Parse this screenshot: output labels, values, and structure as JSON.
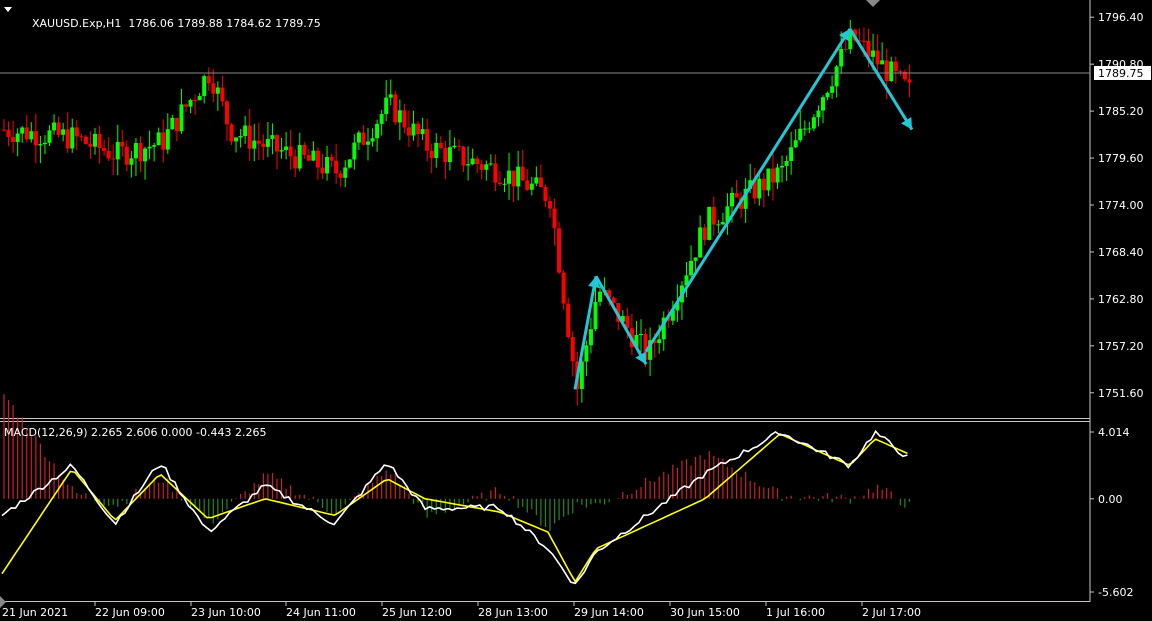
{
  "header": {
    "symbol": "XAUUSD.Exp,H1",
    "ohlc": "1786.06 1789.88 1784.62 1789.75"
  },
  "price_axis": {
    "labels": [
      "1796.40",
      "1790.80",
      "1785.20",
      "1779.60",
      "1774.00",
      "1768.40",
      "1762.80",
      "1757.20",
      "1751.60"
    ],
    "current_price_label": "1789.75"
  },
  "macd": {
    "title": "MACD(12,26,9) 2.265 2.606 0.000 -0.443 2.265",
    "axis_labels": [
      "4.014",
      "0.00",
      "-5.602"
    ]
  },
  "time_axis": {
    "labels": [
      "21 Jun 2021",
      "22 Jun 09:00",
      "23 Jun 10:00",
      "24 Jun 11:00",
      "25 Jun 12:00",
      "28 Jun 13:00",
      "29 Jun 14:00",
      "30 Jun 15:00",
      "1 Jul 16:00",
      "2 Jul 17:00"
    ]
  },
  "colors": {
    "background": "#000000",
    "bull": "#00ff00",
    "bear": "#ff0000",
    "arrow": "#22c8d8",
    "macd_line": "#ffffff",
    "signal_line": "#ffff00",
    "hist_pos": "#cc2222",
    "hist_neg": "#228822"
  },
  "chart_data": [
    {
      "type": "candlestick",
      "title": "XAUUSD.Exp,H1",
      "y_range": [
        1750.5,
        1797.5
      ],
      "current_price": 1789.75,
      "close_path": [
        {
          "x": "21 Jun 2021",
          "y": 1783.0
        },
        {
          "x": "22 Jun 09:00",
          "y": 1782.0
        },
        {
          "x": "22 Jun 09:00+",
          "y": 1780.0
        },
        {
          "x": "23 Jun 10:00",
          "y": 1781.5
        },
        {
          "x": "23 Jun 10:00+",
          "y": 1790.0
        },
        {
          "x": "23 Jun 10:00++",
          "y": 1783.0
        },
        {
          "x": "24 Jun 11:00",
          "y": 1781.0
        },
        {
          "x": "24 Jun 11:00+",
          "y": 1778.0
        },
        {
          "x": "25 Jun 12:00",
          "y": 1786.0
        },
        {
          "x": "25 Jun 12:00+",
          "y": 1781.0
        },
        {
          "x": "28 Jun 13:00",
          "y": 1778.0
        },
        {
          "x": "28 Jun 13:00+",
          "y": 1775.0
        },
        {
          "x": "29 Jun 14:00",
          "y": 1752.0
        },
        {
          "x": "29 Jun 14:00+",
          "y": 1764.0
        },
        {
          "x": "29 Jun 14:00++",
          "y": 1756.0
        },
        {
          "x": "30 Jun 15:00",
          "y": 1772.0
        },
        {
          "x": "1 Jul 16:00",
          "y": 1778.0
        },
        {
          "x": "1 Jul 16:00+",
          "y": 1794.0
        },
        {
          "x": "2 Jul 17:00",
          "y": 1787.0
        },
        {
          "x": "2 Jul 17:00+",
          "y": 1789.75
        }
      ],
      "annotations": [
        {
          "type": "arrow",
          "from": {
            "x": "29 Jun 14:00",
            "y": 1752.0
          },
          "to": {
            "x": "29 Jun 14:00+",
            "y": 1765.5
          }
        },
        {
          "type": "arrow",
          "from": {
            "x": "29 Jun 14:00+",
            "y": 1765.5
          },
          "to": {
            "x": "29 Jun 14:00++",
            "y": 1755.0
          }
        },
        {
          "type": "arrow",
          "from": {
            "x": "29 Jun 14:00++",
            "y": 1756.5
          },
          "to": {
            "x": "1 Jul 16:00+",
            "y": 1795.0
          }
        },
        {
          "type": "arrow",
          "from": {
            "x": "1 Jul 16:00+",
            "y": 1795.0
          },
          "to": {
            "x": "2 Jul 17:00+",
            "y": 1783.0
          }
        }
      ]
    },
    {
      "type": "line",
      "title": "MACD(12,26,9)",
      "y_range": [
        -5.602,
        4.014
      ],
      "values_text": "2.265 2.606 0.000 -0.443 2.265",
      "macd_path": [
        {
          "x": "21 Jun 2021",
          "y": -1.0
        },
        {
          "x": "22 Jun 09:00",
          "y": 2.0
        },
        {
          "x": "22 Jun 09:00+",
          "y": -1.5
        },
        {
          "x": "23 Jun 10:00",
          "y": 2.2
        },
        {
          "x": "23 Jun 10:00+",
          "y": -2.0
        },
        {
          "x": "24 Jun 11:00",
          "y": 0.8
        },
        {
          "x": "24 Jun 11:00+",
          "y": -1.5
        },
        {
          "x": "25 Jun 12:00",
          "y": 2.2
        },
        {
          "x": "25 Jun 12:00+",
          "y": -0.6
        },
        {
          "x": "28 Jun 13:00",
          "y": -0.5
        },
        {
          "x": "28 Jun 13:00+",
          "y": -3.0
        },
        {
          "x": "29 Jun 14:00",
          "y": -5.2
        },
        {
          "x": "29 Jun 14:00+",
          "y": -3.2
        },
        {
          "x": "30 Jun 15:00",
          "y": 1.5
        },
        {
          "x": "1 Jul 16:00",
          "y": 4.0
        },
        {
          "x": "1 Jul 16:00+",
          "y": 2.0
        },
        {
          "x": "1 Jul 16:00++",
          "y": 4.0
        },
        {
          "x": "2 Jul 17:00",
          "y": 2.265
        }
      ],
      "signal_path": [
        {
          "x": "21 Jun 2021",
          "y": -4.5
        },
        {
          "x": "22 Jun 09:00",
          "y": 1.8
        },
        {
          "x": "22 Jun 09:00+",
          "y": -1.3
        },
        {
          "x": "23 Jun 10:00",
          "y": 1.5
        },
        {
          "x": "23 Jun 10:00+",
          "y": -1.2
        },
        {
          "x": "24 Jun 11:00",
          "y": 0.0
        },
        {
          "x": "24 Jun 11:00+",
          "y": -1.0
        },
        {
          "x": "25 Jun 12:00",
          "y": 1.2
        },
        {
          "x": "25 Jun 12:00+",
          "y": 0.0
        },
        {
          "x": "28 Jun 13:00",
          "y": -0.8
        },
        {
          "x": "28 Jun 13:00+",
          "y": -2.0
        },
        {
          "x": "29 Jun 14:00",
          "y": -5.0
        },
        {
          "x": "29 Jun 14:00+",
          "y": -3.0
        },
        {
          "x": "30 Jun 15:00",
          "y": 0.0
        },
        {
          "x": "1 Jul 16:00",
          "y": 3.9
        },
        {
          "x": "1 Jul 16:00+",
          "y": 2.0
        },
        {
          "x": "1 Jul 16:00++",
          "y": 3.6
        },
        {
          "x": "2 Jul 17:00",
          "y": 2.606
        }
      ]
    }
  ]
}
